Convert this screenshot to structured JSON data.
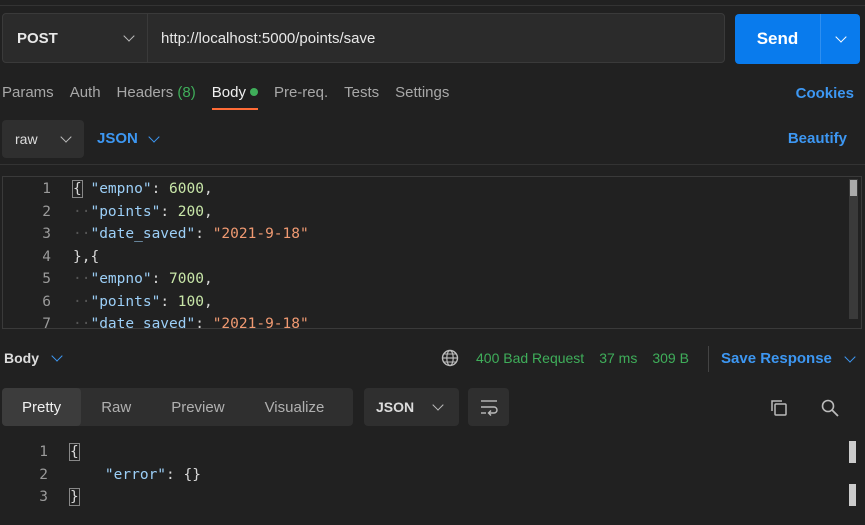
{
  "request": {
    "method": "POST",
    "url": "http://localhost:5000/points/save",
    "send_label": "Send"
  },
  "tabs": [
    {
      "label": "Params"
    },
    {
      "label": "Auth"
    },
    {
      "label": "Headers",
      "count": "(8)"
    },
    {
      "label": "Body"
    },
    {
      "label": "Pre-req."
    },
    {
      "label": "Tests"
    },
    {
      "label": "Settings"
    }
  ],
  "cookies_label": "Cookies",
  "body_toolbar": {
    "mode": "raw",
    "format": "JSON",
    "beautify_label": "Beautify"
  },
  "request_body_lines": [
    {
      "num": "1",
      "tokens": [
        [
          "p",
          "{"
        ],
        [
          "p",
          " "
        ],
        [
          "k",
          "\"empno\""
        ],
        [
          "p",
          ": "
        ],
        [
          "n",
          "6000"
        ],
        [
          "p",
          ","
        ]
      ]
    },
    {
      "num": "2",
      "tokens": [
        [
          "ind",
          "··"
        ],
        [
          "k",
          "\"points\""
        ],
        [
          "p",
          ": "
        ],
        [
          "n",
          "200"
        ],
        [
          "p",
          ","
        ]
      ]
    },
    {
      "num": "3",
      "tokens": [
        [
          "ind",
          "··"
        ],
        [
          "k",
          "\"date_saved\""
        ],
        [
          "p",
          ": "
        ],
        [
          "s",
          "\"2021-9-18\""
        ]
      ]
    },
    {
      "num": "4",
      "tokens": [
        [
          "p",
          "},{"
        ]
      ]
    },
    {
      "num": "5",
      "tokens": [
        [
          "ind",
          "··"
        ],
        [
          "k",
          "\"empno\""
        ],
        [
          "p",
          ": "
        ],
        [
          "n",
          "7000"
        ],
        [
          "p",
          ","
        ]
      ]
    },
    {
      "num": "6",
      "tokens": [
        [
          "ind",
          "··"
        ],
        [
          "k",
          "\"points\""
        ],
        [
          "p",
          ": "
        ],
        [
          "n",
          "100"
        ],
        [
          "p",
          ","
        ]
      ]
    },
    {
      "num": "7",
      "tokens": [
        [
          "ind",
          "··"
        ],
        [
          "k",
          "\"date_saved\""
        ],
        [
          "p",
          ": "
        ],
        [
          "s",
          "\"2021-9-18\""
        ]
      ]
    }
  ],
  "response": {
    "section_label": "Body",
    "status": "400 Bad Request",
    "time": "37 ms",
    "size": "309 B",
    "save_label": "Save Response",
    "view_tabs": [
      {
        "label": "Pretty"
      },
      {
        "label": "Raw"
      },
      {
        "label": "Preview"
      },
      {
        "label": "Visualize"
      }
    ],
    "format": "JSON",
    "lines": [
      {
        "num": "1",
        "tokens": [
          [
            "p",
            "{"
          ]
        ]
      },
      {
        "num": "2",
        "tokens": [
          [
            "p",
            "    "
          ],
          [
            "k",
            "\"error\""
          ],
          [
            "p",
            ": "
          ],
          [
            "p",
            "{}"
          ]
        ]
      },
      {
        "num": "3",
        "tokens": [
          [
            "p",
            "}"
          ]
        ]
      }
    ]
  },
  "colors": {
    "accent": "#097bed",
    "link": "#3d97f2",
    "status_ok_green": "#3fae5a",
    "tab_underline": "#ff6c37",
    "background": "#212121"
  }
}
